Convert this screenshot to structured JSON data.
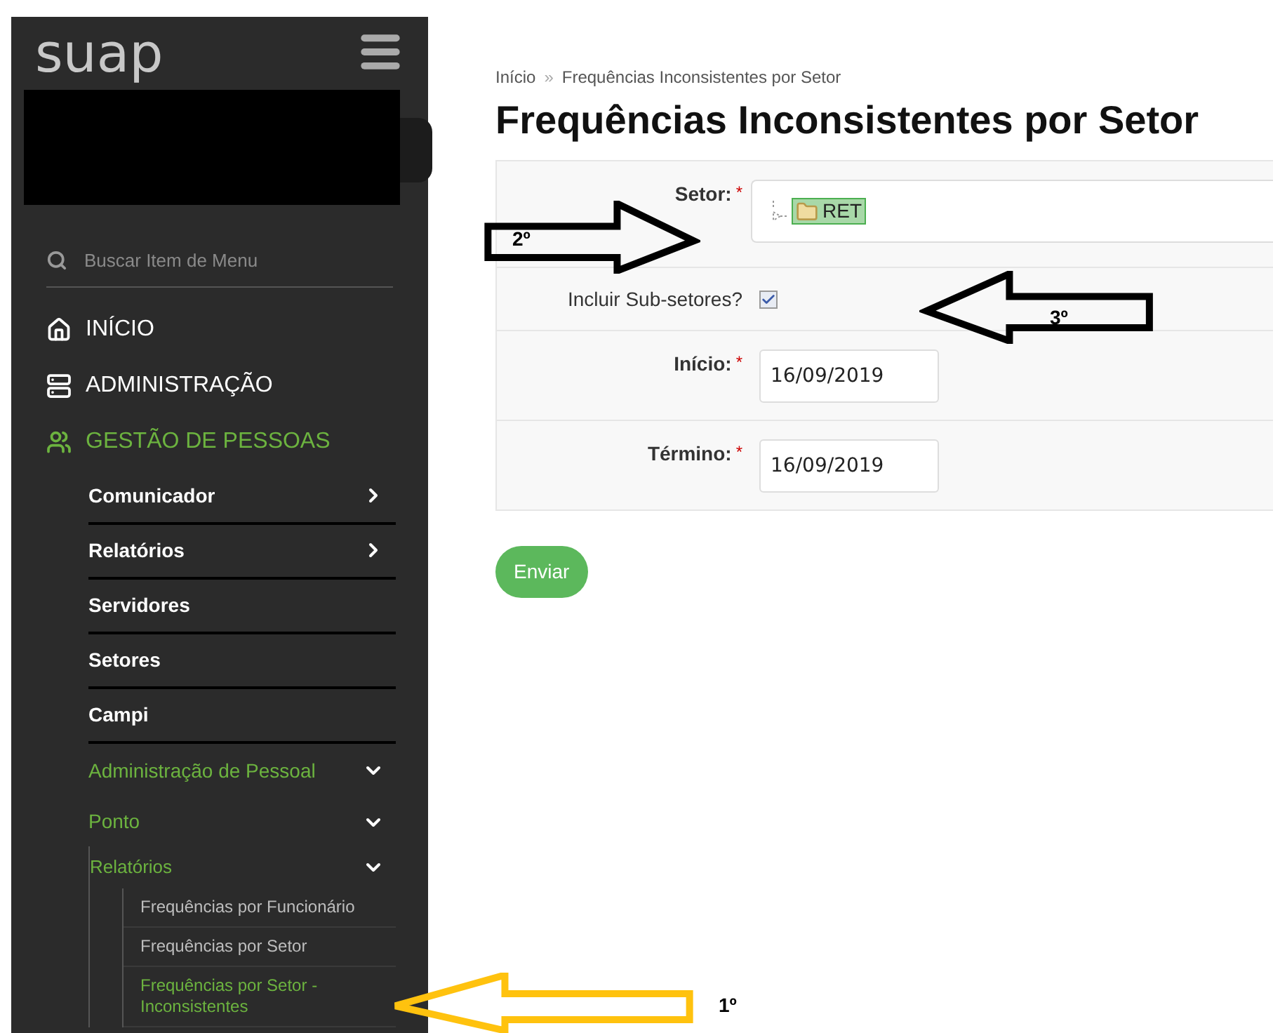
{
  "sidebar": {
    "logo": "suap",
    "search": {
      "placeholder": "Buscar Item de Menu"
    },
    "sections": [
      {
        "label": "INÍCIO",
        "selected": false
      },
      {
        "label": "ADMINISTRAÇÃO",
        "selected": false
      },
      {
        "label": "GESTÃO DE PESSOAS",
        "selected": true
      }
    ],
    "items": [
      {
        "label": "Comunicador",
        "expanded": false
      },
      {
        "label": "Relatórios",
        "expanded": false
      },
      {
        "label": "Servidores"
      },
      {
        "label": "Setores"
      },
      {
        "label": "Campi"
      },
      {
        "label": "Administração de Pessoal",
        "expanded": true,
        "children": [
          {
            "label": "Ponto",
            "expanded": true,
            "children": [
              {
                "label": "Relatórios",
                "expanded": true,
                "children": [
                  {
                    "label": "Frequências por Funcionário",
                    "selected": false
                  },
                  {
                    "label": "Frequências por Setor",
                    "selected": false
                  },
                  {
                    "label": "Frequências por Setor - Inconsistentes",
                    "selected": true
                  }
                ]
              }
            ]
          }
        ]
      }
    ]
  },
  "breadcrumb": [
    "Início",
    "Frequências Inconsistentes por Setor"
  ],
  "breadcrumb_separator": "»",
  "title": "Frequências Inconsistentes por Setor",
  "form": {
    "fields": [
      {
        "kind": "tree",
        "label": "Setor:",
        "required": true,
        "value": "RET"
      },
      {
        "kind": "checkbox",
        "label": "Incluir Sub-setores?",
        "required": false,
        "checked": true
      },
      {
        "kind": "date",
        "label": "Início:",
        "required": true,
        "value": "16/09/2019"
      },
      {
        "kind": "date",
        "label": "Término:",
        "required": true,
        "value": "16/09/2019"
      }
    ],
    "required_mark": "*",
    "submit": "Enviar"
  },
  "annotations": [
    {
      "label": "2º",
      "color": "#000000"
    },
    {
      "label": "3º",
      "color": "#000000"
    },
    {
      "label": "1º",
      "color": "#ffc20e"
    }
  ]
}
